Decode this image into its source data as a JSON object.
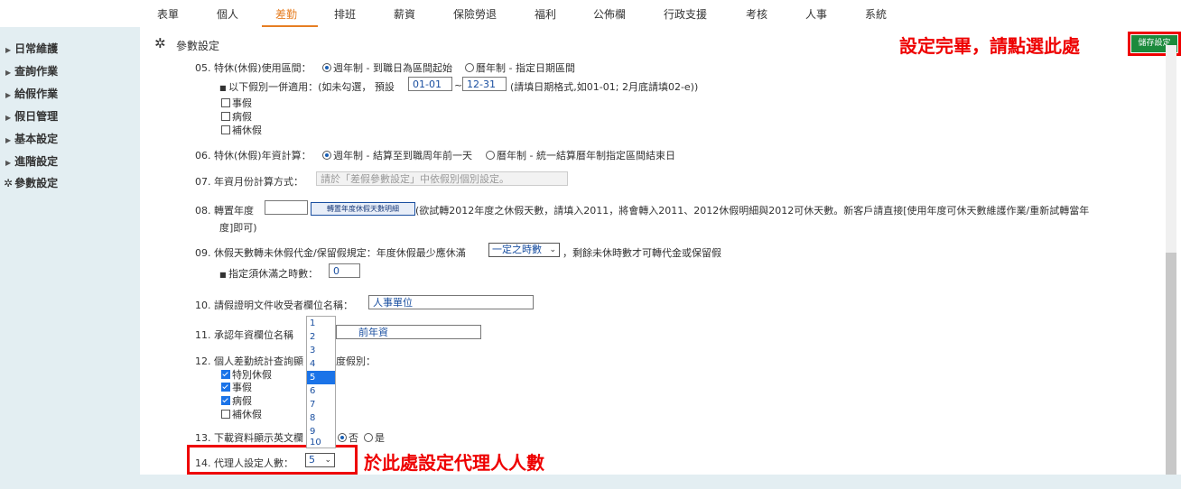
{
  "topnav": {
    "items": [
      "表單",
      "個人",
      "差勤",
      "排班",
      "薪資",
      "保險勞退",
      "福利",
      "公佈欄",
      "行政支援",
      "考核",
      "人事",
      "系統"
    ],
    "active_index": 2
  },
  "sidebar": {
    "items": [
      "日常維護",
      "查詢作業",
      "給假作業",
      "假日管理",
      "基本設定",
      "進階設定",
      "參數設定"
    ]
  },
  "page_title": "參數設定",
  "save_button": "儲存設定",
  "annotations": {
    "save_hint": "設定完畢，請點選此處",
    "agent_hint": "於此處設定代理人人數"
  },
  "items": {
    "i05": {
      "label": "05.  特休(休假)使用區間：",
      "opt1": "週年制 - 到職日為區間起始",
      "opt2": "曆年制 - 指定日期區間",
      "sub_label": "以下假別一併適用：(如未勾選， 預設",
      "date_from": "01-01",
      "tilde": "~",
      "date_to": "12-31",
      "date_hint": "(請填日期格式,如01-01; 2月底請填02-e))",
      "checks": [
        "事假",
        "病假",
        "補休假"
      ]
    },
    "i06": {
      "label": "06.  特休(休假)年資計算：",
      "opt1": "週年制 - 結算至到職周年前一天",
      "opt2": "曆年制 - 統一結算曆年制指定區間結束日"
    },
    "i07": {
      "label": "07.  年資月份計算方式：",
      "placeholder": "請於「差假參數設定」中依假別個別設定。"
    },
    "i08": {
      "label": "08.  轉置年度",
      "button": "轉置年度休假天數明細",
      "desc1": "(欲試轉2012年度之休假天數，請填入2011，將會轉入2011、2012休假明細與2012可休天數。新客戶請直接[使用年度可休天數維護作業/重新試轉當年",
      "desc2": "度]即可)"
    },
    "i09": {
      "label": "09.  休假天數轉未休假代金/保留假規定：年度休假最少應休滿",
      "select": "一定之時數",
      "after": "，剩餘未休時數才可轉代金或保留假",
      "sub_label": "指定須休滿之時數：",
      "value": "0"
    },
    "i10": {
      "label": "10.  請假證明文件收受者欄位名稱：",
      "value": "人事單位"
    },
    "i11": {
      "label": "11.  承認年資欄位名稱",
      "value": "前年資"
    },
    "i12": {
      "label": "12.  個人差勤統計查詢顯",
      "label2": "度假別：",
      "checks": [
        "特別休假",
        "事假",
        "病假",
        "補休假"
      ],
      "checked": [
        true,
        true,
        true,
        false
      ]
    },
    "i13": {
      "label": "13.  下載資料顯示英文欄",
      "opt1": "否",
      "opt2": "是"
    },
    "i14": {
      "label": "14.  代理人設定人數：",
      "value": "5"
    }
  },
  "dropdown": {
    "options": [
      "1",
      "2",
      "3",
      "4",
      "5",
      "6",
      "7",
      "8",
      "9",
      "10"
    ],
    "selected": "5"
  },
  "colors": {
    "accent": "#e67e22",
    "sidebar_bg": "#e3eef2",
    "save_bg": "#1b8a3c",
    "annotation": "#ee0000"
  }
}
